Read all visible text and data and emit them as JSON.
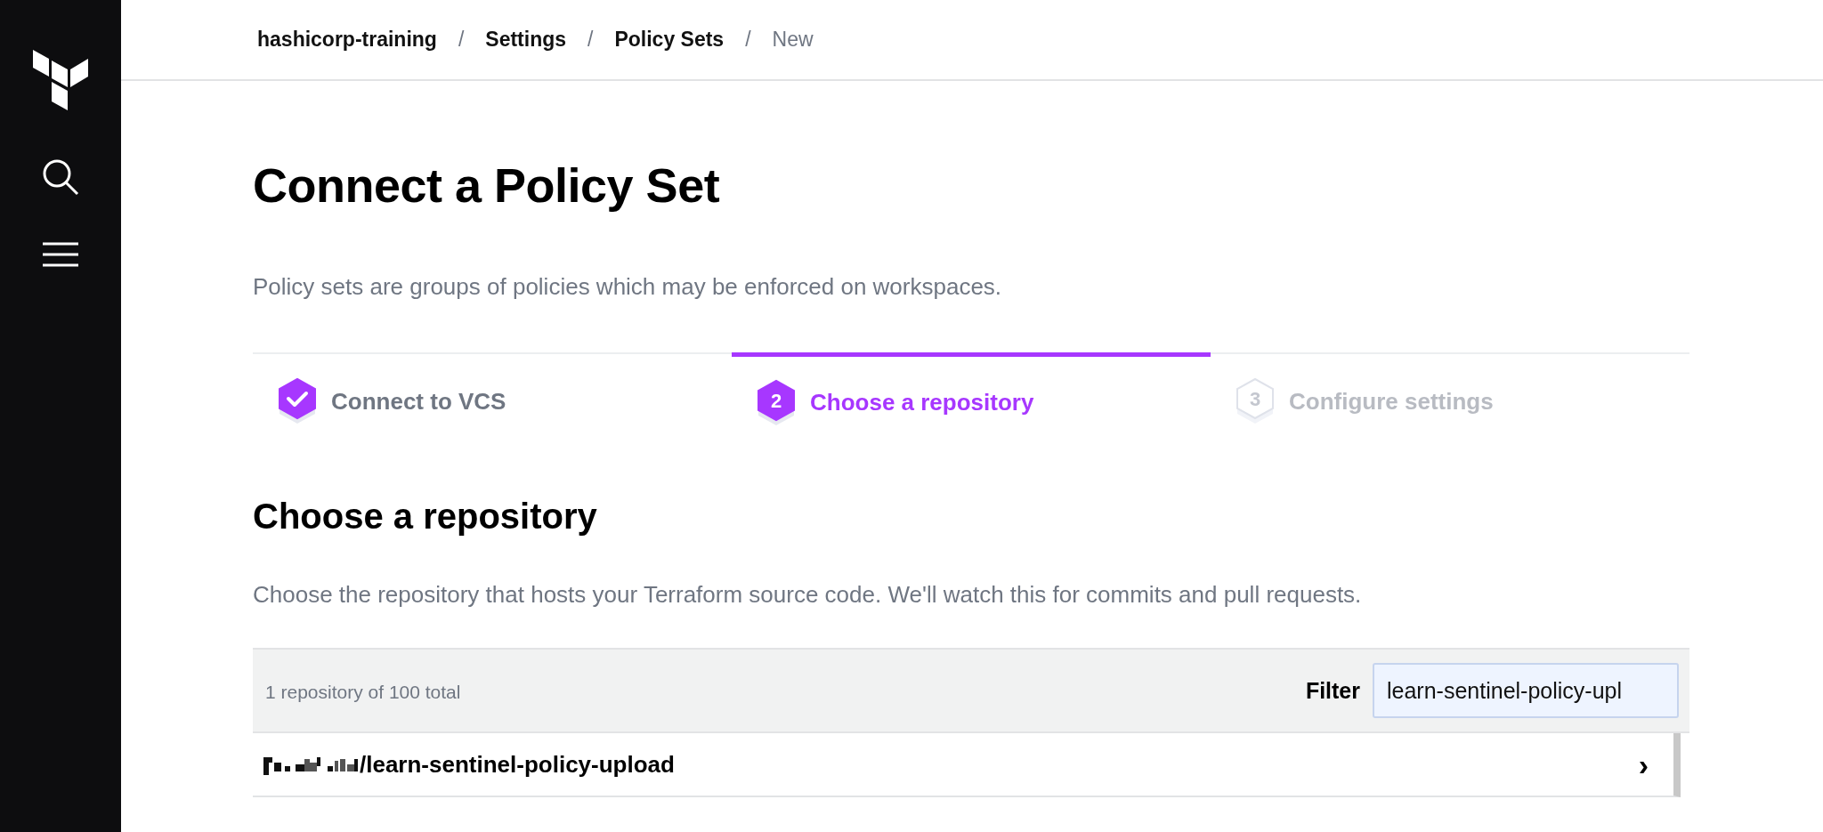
{
  "breadcrumbs": [
    {
      "label": "hashicorp-training",
      "current": false
    },
    {
      "label": "Settings",
      "current": false
    },
    {
      "label": "Policy Sets",
      "current": false
    },
    {
      "label": "New",
      "current": true
    }
  ],
  "separator": "/",
  "title": "Connect a Policy Set",
  "description": "Policy sets are groups of policies which may be enforced on workspaces.",
  "steps": [
    {
      "kind": "complete",
      "label": "Connect to VCS"
    },
    {
      "kind": "current",
      "number": "2",
      "label": "Choose a repository"
    },
    {
      "kind": "upcoming",
      "number": "3",
      "label": "Configure settings"
    }
  ],
  "section": {
    "title": "Choose a repository",
    "description": "Choose the repository that hosts your Terraform source code. We'll watch this for commits and pull requests."
  },
  "table": {
    "count": "1 repository of 100 total",
    "filter_label": "Filter",
    "filter_value": "learn-sentinel-policy-upl",
    "rows": [
      {
        "name": "/learn-sentinel-policy-upload",
        "owner_redacted": true,
        "chevron": "›"
      }
    ]
  }
}
